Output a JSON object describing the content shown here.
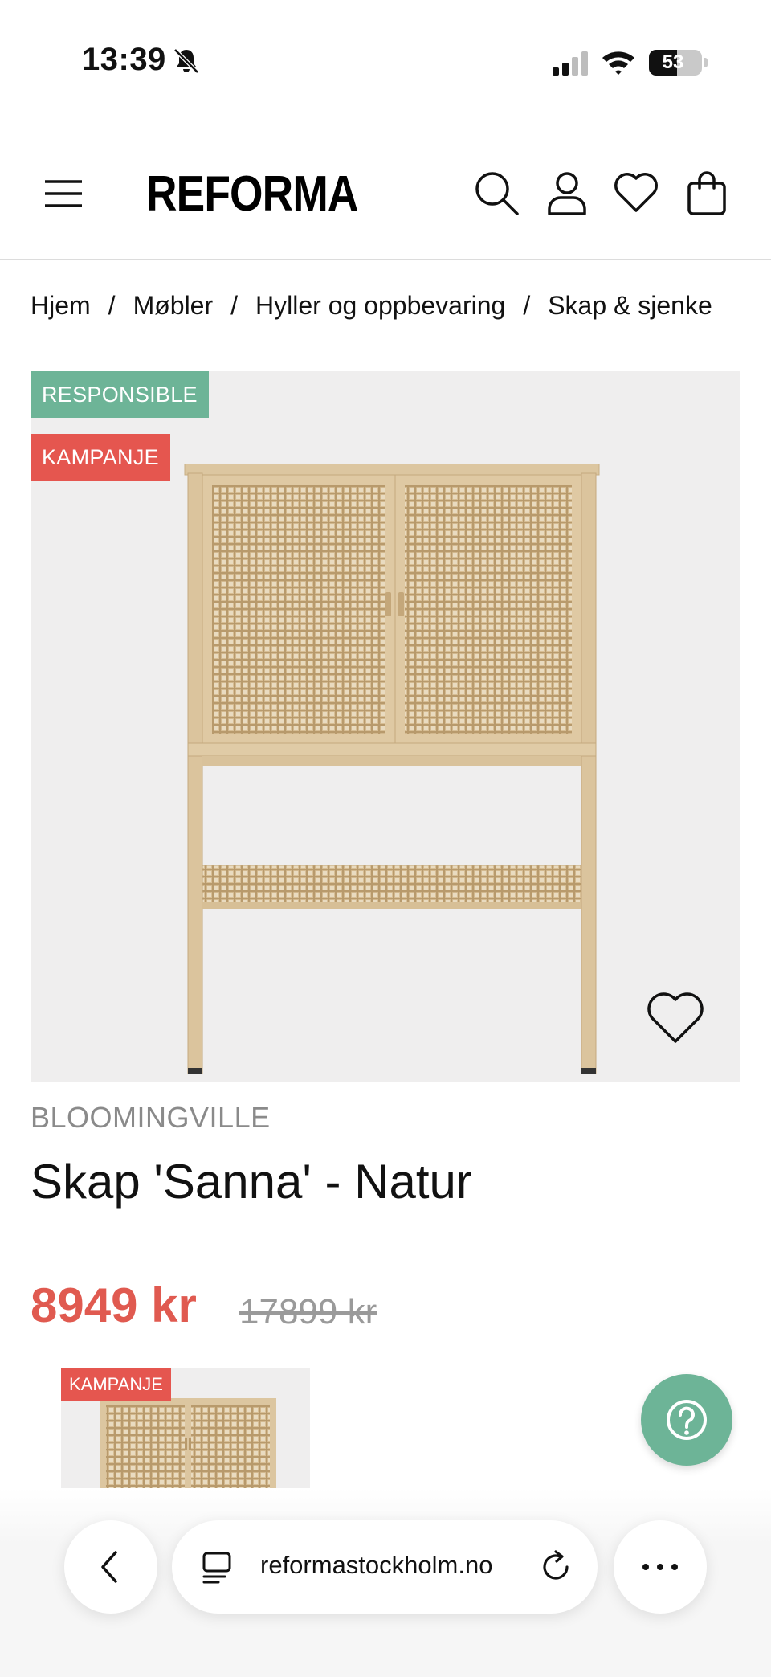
{
  "status_bar": {
    "time": "13:39",
    "battery_level": "53",
    "battery_fraction": 0.53,
    "icons": [
      "bell-slash-icon",
      "signal-icon",
      "wifi-icon",
      "battery-icon"
    ]
  },
  "header": {
    "logo": "REFORMA",
    "icons": [
      "menu-icon",
      "search-icon",
      "user-icon",
      "heart-icon",
      "bag-icon"
    ]
  },
  "breadcrumb": {
    "items": [
      "Hjem",
      "Møbler",
      "Hyller og oppbevaring",
      "Skap & sjenke"
    ],
    "separator": "/"
  },
  "product": {
    "badges": {
      "responsible": "RESPONSIBLE",
      "campaign": "KAMPANJE"
    },
    "brand": "BLOOMINGVILLE",
    "title": "Skap 'Sanna' - Natur",
    "price": "8949 kr",
    "old_price": "17899 kr",
    "thumbnail_badge": "KAMPANJE"
  },
  "browser": {
    "url": "reformastockholm.no",
    "icons": [
      "chevron-left-icon",
      "tabs-icon",
      "reload-icon",
      "more-icon"
    ]
  },
  "colors": {
    "accent_green": "#6db497",
    "campaign_red": "#e5564f",
    "price_red": "#e05a50"
  }
}
